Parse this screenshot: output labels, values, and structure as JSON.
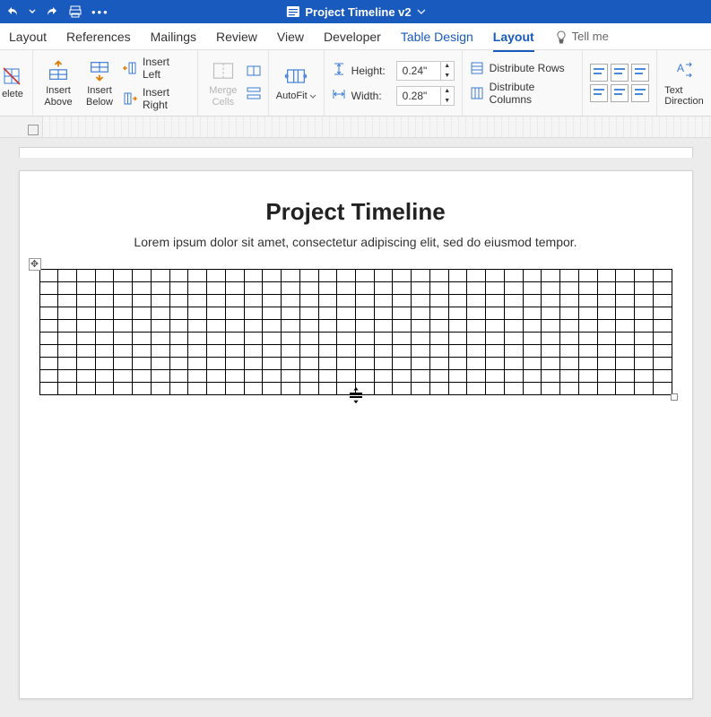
{
  "titlebar": {
    "doc_name": "Project Timeline v2"
  },
  "tabs": {
    "layout1": "Layout",
    "references": "References",
    "mailings": "Mailings",
    "review": "Review",
    "view": "View",
    "developer": "Developer",
    "table_design": "Table Design",
    "table_layout": "Layout",
    "tell_me": "Tell me"
  },
  "ribbon": {
    "delete": "elete",
    "insert_above": "Insert\nAbove",
    "insert_below": "Insert\nBelow",
    "insert_left": "Insert Left",
    "insert_right": "Insert Right",
    "merge_cells": "Merge\nCells",
    "autofit": "AutoFit",
    "height_label": "Height:",
    "height_value": "0.24\"",
    "width_label": "Width:",
    "width_value": "0.28\"",
    "distribute_rows": "Distribute Rows",
    "distribute_columns": "Distribute Columns",
    "text_direction": "Text\nDirection"
  },
  "document": {
    "title": "Project Timeline",
    "body": "Lorem ipsum dolor sit amet, consectetur adipiscing elit, sed do eiusmod tempor.",
    "table_rows": 10,
    "table_cols": 34
  }
}
